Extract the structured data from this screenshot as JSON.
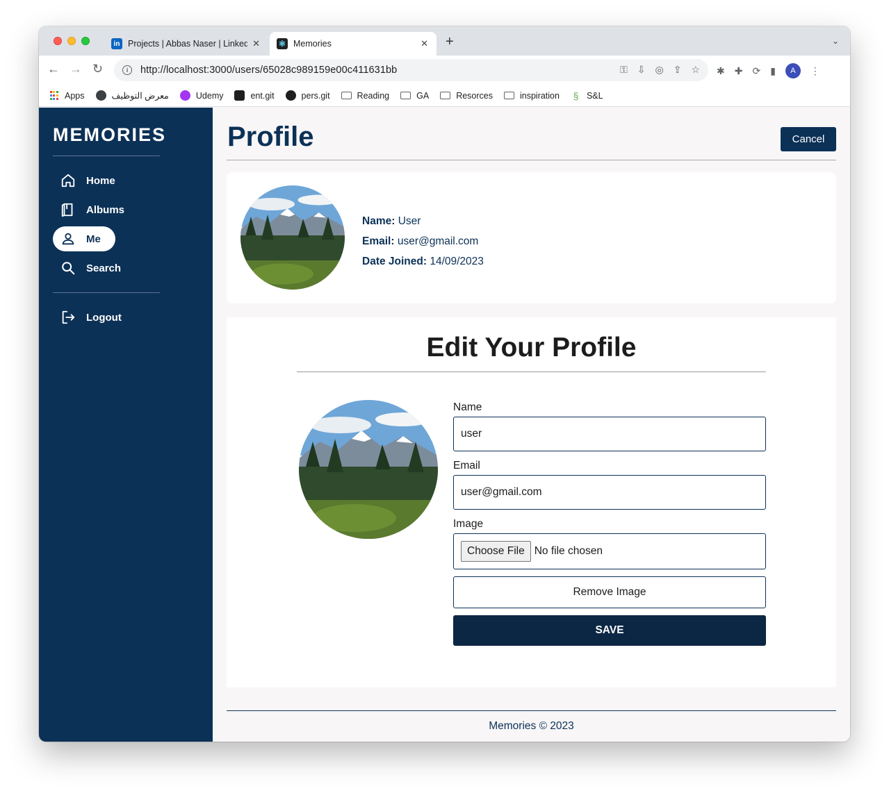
{
  "browser": {
    "tabs": [
      {
        "title": "Projects | Abbas Naser | LinkedIn",
        "active": false,
        "favicon": "linkedin-icon"
      },
      {
        "title": "Memories",
        "active": true,
        "favicon": "react-icon"
      }
    ],
    "url": "http://localhost:3000/users/65028c989159e00c411631bb",
    "avatar_letter": "A",
    "bookmarks": [
      {
        "label": "Apps",
        "icon": "apps-grid-icon"
      },
      {
        "label": "معرض التوظيف",
        "icon": "globe-icon"
      },
      {
        "label": "Udemy",
        "icon": "udemy-icon"
      },
      {
        "label": "ent.git",
        "icon": "github-icon"
      },
      {
        "label": "pers.git",
        "icon": "github-icon"
      },
      {
        "label": "Reading",
        "icon": "folder-icon"
      },
      {
        "label": "GA",
        "icon": "folder-icon"
      },
      {
        "label": "Resorces",
        "icon": "folder-icon"
      },
      {
        "label": "inspiration",
        "icon": "folder-icon"
      },
      {
        "label": "S&L",
        "icon": "snake-icon"
      }
    ]
  },
  "sidebar": {
    "brand": "MEMORIES",
    "items": [
      {
        "label": "Home",
        "icon": "home-icon",
        "active": false
      },
      {
        "label": "Albums",
        "icon": "albums-icon",
        "active": false
      },
      {
        "label": "Me",
        "icon": "user-icon",
        "active": true
      },
      {
        "label": "Search",
        "icon": "search-icon",
        "active": false
      }
    ],
    "logout": {
      "label": "Logout",
      "icon": "logout-icon"
    }
  },
  "main": {
    "title": "Profile",
    "cancel_label": "Cancel",
    "profile": {
      "name_label": "Name:",
      "name_value": "User",
      "email_label": "Email:",
      "email_value": "user@gmail.com",
      "date_label": "Date Joined:",
      "date_value": "14/09/2023"
    },
    "edit": {
      "title": "Edit Your Profile",
      "name_label": "Name",
      "name_value": "user",
      "email_label": "Email",
      "email_value": "user@gmail.com",
      "image_label": "Image",
      "choose_file_label": "Choose File",
      "no_file_text": "No file chosen",
      "remove_label": "Remove Image",
      "save_label": "SAVE"
    },
    "footer": "Memories © 2023"
  },
  "colors": {
    "navy": "#0c3157",
    "save_button": "#0c2744",
    "page_bg": "#f8f6f7"
  }
}
